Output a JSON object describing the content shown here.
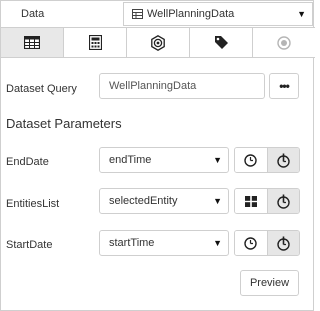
{
  "header": {
    "label": "Data",
    "dataset_selected": "WellPlanningData",
    "dataset_icon": "table-icon"
  },
  "tabs": [
    {
      "name": "table",
      "icon": "table-icon",
      "active": true
    },
    {
      "name": "calculator",
      "icon": "calculator-icon",
      "active": false
    },
    {
      "name": "settings",
      "icon": "gear-icon",
      "active": false
    },
    {
      "name": "tag",
      "icon": "tag-icon",
      "active": false
    },
    {
      "name": "record",
      "icon": "radio-target-icon",
      "active": false,
      "disabled": true
    }
  ],
  "query": {
    "label": "Dataset Query",
    "value": "WellPlanningData",
    "more_button": "•••"
  },
  "parameters": {
    "title": "Dataset Parameters",
    "items": [
      {
        "label": "EndDate",
        "value": "endTime",
        "btn1_icon": "clock-icon",
        "btn2_icon": "pointer-icon"
      },
      {
        "label": "EntitiesList",
        "value": "selectedEntity",
        "btn1_icon": "grid-icon",
        "btn2_icon": "pointer-icon"
      },
      {
        "label": "StartDate",
        "value": "startTime",
        "btn1_icon": "clock-icon",
        "btn2_icon": "pointer-icon"
      }
    ]
  },
  "preview_button": "Preview",
  "colors": {
    "border": "#cfcfcf",
    "active_bg": "#e8e8e8",
    "text": "#333333"
  }
}
